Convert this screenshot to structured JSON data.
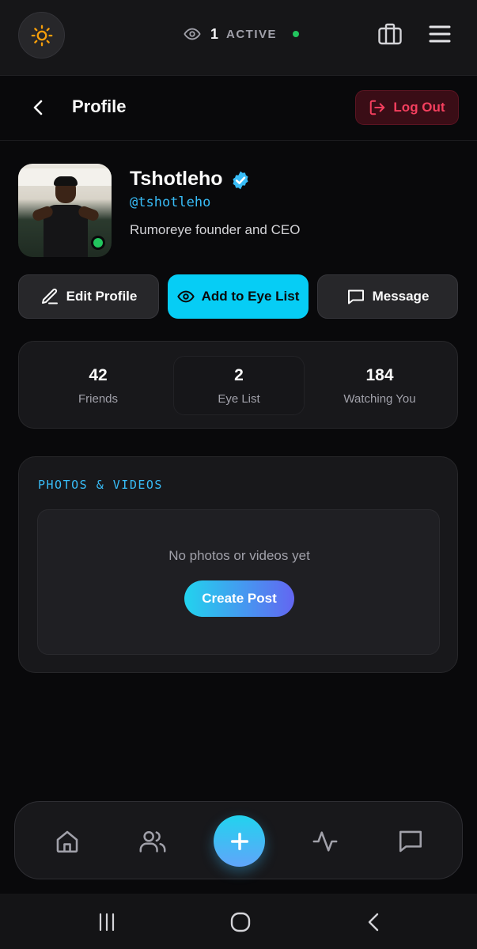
{
  "topbar": {
    "active_count": "1",
    "active_label": "ACTIVE"
  },
  "header": {
    "title": "Profile",
    "logout_label": "Log Out"
  },
  "profile": {
    "display_name": "Tshotleho",
    "handle": "@tshotleho",
    "bio": "Rumoreye founder and CEO",
    "verified": true,
    "online": true
  },
  "actions": {
    "edit_label": "Edit Profile",
    "eyelist_label": "Add to Eye List",
    "message_label": "Message"
  },
  "stats": [
    {
      "value": "42",
      "label": "Friends"
    },
    {
      "value": "2",
      "label": "Eye List"
    },
    {
      "value": "184",
      "label": "Watching You"
    }
  ],
  "media": {
    "title": "PHOTOS & VIDEOS",
    "empty_text": "No photos or videos yet",
    "create_label": "Create Post"
  },
  "icons": {
    "theme": "sun-icon",
    "eye": "eye-icon",
    "briefcase": "briefcase-icon",
    "menu": "menu-icon",
    "back": "chevron-left-icon",
    "logout": "logout-icon",
    "verified": "verified-badge-icon",
    "edit": "pencil-icon",
    "message": "message-icon",
    "nav_home": "home-icon",
    "nav_friends": "users-icon",
    "nav_add": "plus-icon",
    "nav_activity": "activity-icon",
    "nav_chat": "chat-icon"
  },
  "colors": {
    "accent_cyan": "#06cdf5",
    "danger": "#f43f5e",
    "online_green": "#22c55e",
    "handle_blue": "#38bdf8",
    "background": "#09090b"
  }
}
